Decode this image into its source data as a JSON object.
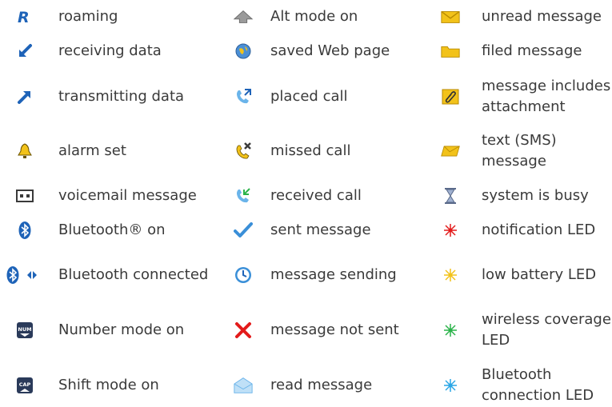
{
  "legend": {
    "rows": [
      [
        "roaming",
        "Alt mode on",
        "unread message"
      ],
      [
        "receiving data",
        "saved Web page",
        "filed message"
      ],
      [
        "transmitting data",
        "placed call",
        "message includes attachment"
      ],
      [
        "alarm set",
        "missed call",
        "text (SMS) message"
      ],
      [
        "voicemail message",
        "received call",
        "system is busy"
      ],
      [
        "Bluetooth® on",
        "sent message",
        "notification LED"
      ],
      [
        "Bluetooth connected",
        "message sending",
        "low battery LED"
      ],
      [
        "Number mode on",
        "message not sent",
        "wireless coverage LED"
      ],
      [
        "Shift mode on",
        "read message",
        "Bluetooth connection LED"
      ]
    ],
    "icons": {
      "roaming": "roaming-R-icon",
      "receiving": "arrow-down-left-icon",
      "transmitting": "arrow-up-right-icon",
      "alarm": "bell-icon",
      "voicemail": "voicemail-icon",
      "bt_on": "bluetooth-icon",
      "bt_connected": "bluetooth-connected-icon",
      "num": "num-key-icon",
      "cap": "cap-key-icon",
      "alt": "alt-arrow-icon",
      "web": "globe-icon",
      "placed": "placed-call-icon",
      "missed": "missed-call-icon",
      "received": "received-call-icon",
      "sent": "checkmark-icon",
      "sending": "clock-icon",
      "not_sent": "red-x-icon",
      "read": "open-envelope-icon",
      "unread": "closed-envelope-icon",
      "filed": "folder-icon",
      "attachment": "paperclip-icon",
      "sms": "sms-envelope-icon",
      "busy": "hourglass-icon",
      "led_red": "red-led-icon",
      "led_yellow": "yellow-led-icon",
      "led_green": "green-led-icon",
      "led_blue": "blue-led-icon"
    },
    "colors": {
      "blue": "#1e63b8",
      "red": "#e31b1b",
      "yellow": "#f2c21a",
      "green": "#2bb34a",
      "cyan": "#29a6e6",
      "text": "#3a3a3a"
    }
  }
}
